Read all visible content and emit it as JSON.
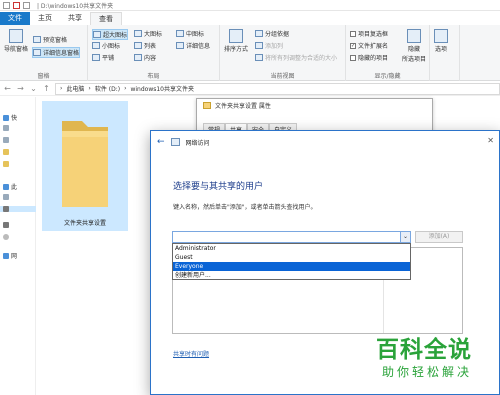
{
  "window": {
    "path": "| D:\\windows10共享文件夹"
  },
  "ribbon_tabs": [
    "文件",
    "主页",
    "共享",
    "查看"
  ],
  "ribbon": {
    "nav_pane": "导航窗格",
    "preview_pane": "预览窗格",
    "details_pane": "详细信息窗格",
    "pane_group": "窗格",
    "xl_icons": "超大图标",
    "large_icons": "大图标",
    "medium_icons": "中图标",
    "small_icons": "小图标",
    "list": "列表",
    "details": "详细信息",
    "tiles": "平铺",
    "content": "内容",
    "layout_group": "布局",
    "sort_by": "排序方式",
    "group_by": "分组依据",
    "add_columns": "添加列",
    "size_columns": "将所有列调整为合适的大小",
    "current_view_group": "当前视图",
    "item_checkboxes": "项目复选框",
    "file_extensions": "文件扩展名",
    "hidden_items": "隐藏的项目",
    "hide_selected_1": "隐藏",
    "hide_selected_2": "所选项目",
    "show_hide_group": "显示/隐藏",
    "options": "选项"
  },
  "address": {
    "path1": "此电脑",
    "path2": "软件 (D:)",
    "path3": "windows10共享文件夹"
  },
  "nav_pane_items": [
    "快",
    "此",
    "网"
  ],
  "folder": {
    "name": "文件夹共享设置"
  },
  "props_dialog": {
    "title": "文件夹共享设置 属性",
    "tabs": [
      "常规",
      "共享",
      "安全",
      "自定义"
    ]
  },
  "dialog": {
    "title": "网络访问",
    "heading": "选择要与其共享的用户",
    "instruction": "键入名称，然后单击\"添加\"，或者单击箭头查找用户。",
    "add_button": "添加(A)",
    "dropdown_options": [
      "Administrator",
      "Guest",
      "Everyone",
      "创建新用户..."
    ],
    "selected_option": "Everyone",
    "help_link": "共享时有问题"
  },
  "watermark": {
    "line1": "百科全说",
    "line2": "助你轻松解决"
  }
}
